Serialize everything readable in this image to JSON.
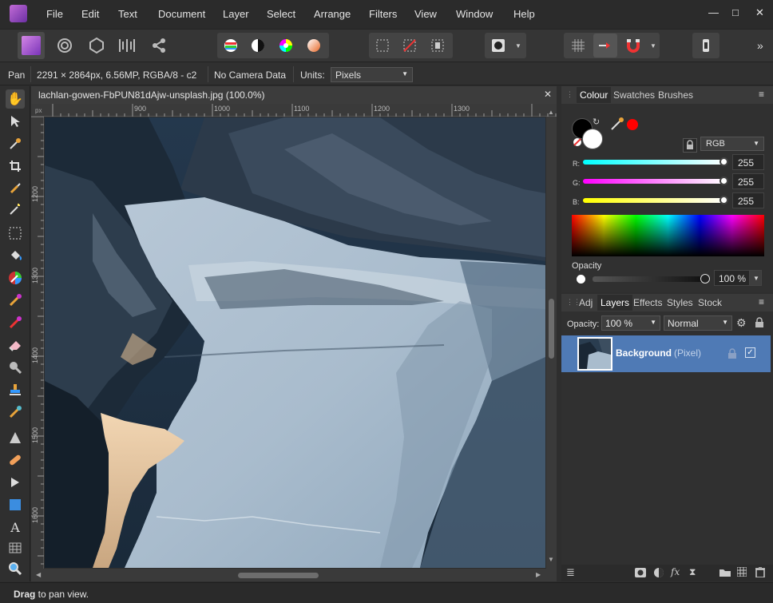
{
  "menu": [
    "File",
    "Edit",
    "Text",
    "Document",
    "Layer",
    "Select",
    "Arrange",
    "Filters",
    "View",
    "Window",
    "Help"
  ],
  "window_controls": {
    "minimize": "—",
    "maximize": "□",
    "close": "✕"
  },
  "toolbar": {
    "overflow": "»"
  },
  "context": {
    "tool": "Pan",
    "doc_info": "2291 × 2864px, 6.56MP, RGBA/8 - c2",
    "camera": "No Camera Data",
    "units_label": "Units:",
    "units_value": "Pixels"
  },
  "document": {
    "tab_title": "lachlan-gowen-FbPUN81dAjw-unsplash.jpg (100.0%)",
    "close": "✕",
    "ruler_unit": "px",
    "ruler_top": [
      "900",
      "1000",
      "1100",
      "1200",
      "1300"
    ],
    "ruler_left": [
      "1200",
      "1300",
      "1400",
      "1500",
      "1600"
    ]
  },
  "colour_panel": {
    "tabs": [
      "Colour",
      "Swatches",
      "Brushes"
    ],
    "model": "RGB",
    "r_label": "R:",
    "g_label": "G:",
    "b_label": "B:",
    "r": "255",
    "g": "255",
    "b": "255",
    "opacity_label": "Opacity",
    "opacity": "100 %",
    "swatch_color": "#ff0000"
  },
  "layers_panel": {
    "tabs": [
      "Adj",
      "Layers",
      "Effects",
      "Styles",
      "Stock"
    ],
    "opacity_label": "Opacity:",
    "opacity": "100 %",
    "blend_mode": "Normal",
    "layer_name": "Background",
    "layer_type": "(Pixel)"
  },
  "status": {
    "bold": "Drag",
    "rest": " to pan view."
  },
  "colors": {
    "accent": "#4f7ab5",
    "brand": "#9b4dca"
  }
}
